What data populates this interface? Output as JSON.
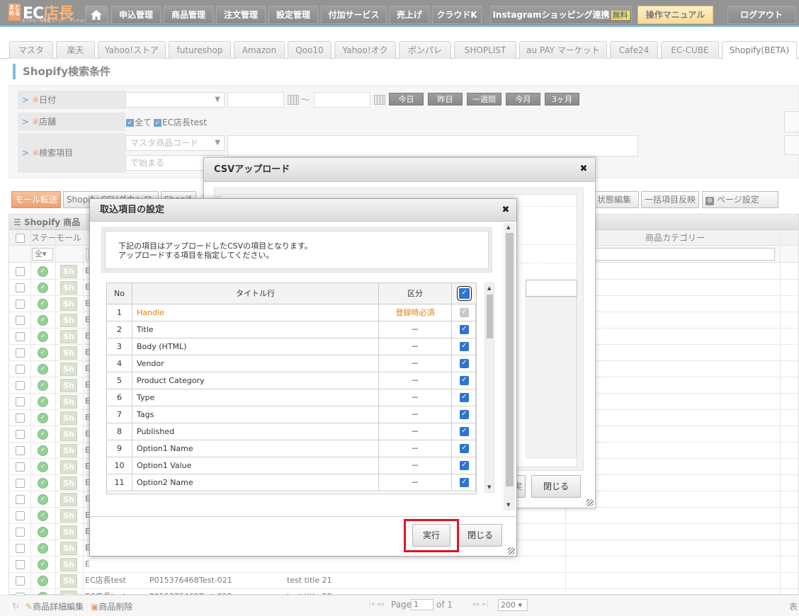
{
  "header": {
    "logo": {
      "badge": "まとめる",
      "brand_prefix": "EC",
      "brand_suffix": "店長",
      "tagline": "おてがる一括管理 イーシー・テンチョウ"
    },
    "nav": [
      {
        "label": "申込管理"
      },
      {
        "label": "商品管理"
      },
      {
        "label": "注文管理"
      },
      {
        "label": "設定管理"
      },
      {
        "label": "付加サービス"
      },
      {
        "label": "売上げ"
      },
      {
        "label": "クラウドK"
      }
    ],
    "instagram": {
      "label": "Instagramショッピング連携",
      "badge": "無料"
    },
    "manual_label": "操作マニュアル",
    "logout_label": "ログアウト"
  },
  "channel_tabs": [
    "マスタ",
    "楽天",
    "Yahoo!ストア",
    "futureshop",
    "Amazon",
    "Qoo10",
    "Yahoo!オク",
    "ポンパレ",
    "SHOPLIST",
    "au PAY マーケット",
    "Cafe24",
    "EC-CUBE",
    "Shopify(BETA)"
  ],
  "active_tab": "Shopify(BETA)",
  "page_title": "Shopify検索条件",
  "search": {
    "date_label": "日付",
    "req_mark": "※",
    "tilde": "～",
    "date_buttons": [
      "今日",
      "昨日",
      "一週間",
      "今月",
      "3ヶ月"
    ],
    "store_label": "店舗",
    "store_all": "全て",
    "store_name": "EC店長test",
    "item_label": "検索項目",
    "item_select": "マスタ商品コード",
    "match_select": "で始まる"
  },
  "toolbar": {
    "mall_transfer": "モール転送",
    "csv_download": "Shopify CSVダウンロード",
    "shopify_short": "Shopif",
    "status_edit": "状態編集",
    "bulk_reflect": "一括項目反映",
    "page_settings": "ページ設定"
  },
  "grid": {
    "title": "Shopify 商品",
    "col_status": "ステー",
    "col_mall": "モール",
    "col_category": "商品カテゴリー",
    "filter_select": "全",
    "sh_label": "Sh",
    "rows_partial_letter": "E",
    "rows": [
      {
        "store": "EC店長test",
        "code": "P015376468",
        "test_id": "Test-021",
        "title": "test title 21"
      },
      {
        "store": "EC店長test",
        "code": "P015376469",
        "test_id": "Test-022",
        "title": "test title 22"
      }
    ]
  },
  "footer": {
    "detail_edit": "商品詳細編集",
    "delete": "商品削除",
    "page_label": "Page",
    "page_value": "1",
    "of_label": "of 1",
    "per_page": "200",
    "right_text": "表"
  },
  "csv_dialog": {
    "title": "CSVアップロード",
    "close_label": "閉じる",
    "hidden_button_tail": "実"
  },
  "import_dialog": {
    "title": "取込項目の設定",
    "note_line1": "下記の項目はアップロードしたCSVの項目となります。",
    "note_line2": "アップロードする項目を指定してください。",
    "headers": {
      "no": "No",
      "title": "タイトル行",
      "kubun": "区分"
    },
    "rows": [
      {
        "no": "1",
        "title": "Handle",
        "kubun": "登録時必須",
        "required": true
      },
      {
        "no": "2",
        "title": "Title",
        "kubun": "－"
      },
      {
        "no": "3",
        "title": "Body (HTML)",
        "kubun": "－"
      },
      {
        "no": "4",
        "title": "Vendor",
        "kubun": "－"
      },
      {
        "no": "5",
        "title": "Product Category",
        "kubun": "－"
      },
      {
        "no": "6",
        "title": "Type",
        "kubun": "－"
      },
      {
        "no": "7",
        "title": "Tags",
        "kubun": "－"
      },
      {
        "no": "8",
        "title": "Published",
        "kubun": "－"
      },
      {
        "no": "9",
        "title": "Option1 Name",
        "kubun": "－"
      },
      {
        "no": "10",
        "title": "Option1 Value",
        "kubun": "－"
      },
      {
        "no": "11",
        "title": "Option2 Name",
        "kubun": "－"
      }
    ],
    "execute_label": "実行",
    "close_label": "閉じる"
  },
  "colors": {
    "accent": "#3b9bd2",
    "required_orange": "#e0800e",
    "highlight_red": "#e0151f",
    "checkbox_blue": "#2f74d0"
  }
}
